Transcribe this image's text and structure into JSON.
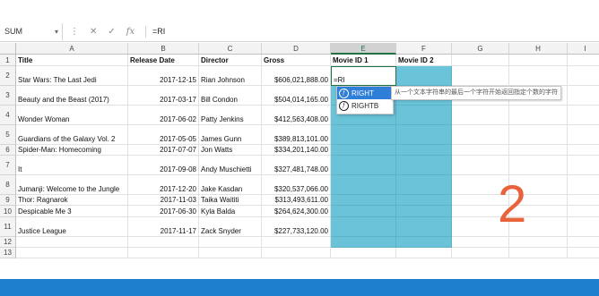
{
  "formula_bar": {
    "name_box": "SUM",
    "cancel_icon": "✕",
    "enter_icon": "✓",
    "fx_label": "fx",
    "formula": "=RI"
  },
  "columns": [
    "A",
    "B",
    "C",
    "D",
    "E",
    "F",
    "G",
    "H",
    "I"
  ],
  "rows": [
    {
      "num": "1",
      "cells": [
        "Title",
        "Release Date",
        "Director",
        "Gross",
        "Movie ID 1",
        "Movie ID 2"
      ]
    },
    {
      "num": "2",
      "cells": [
        "Star Wars: The Last Jedi",
        "2017-12-15",
        "Rian Johnson",
        "$606,021,888.00",
        "=RI",
        ""
      ]
    },
    {
      "num": "3",
      "cells": [
        "Beauty and the Beast (2017)",
        "2017-03-17",
        "Bill Condon",
        "$504,014,165.00",
        "",
        ""
      ]
    },
    {
      "num": "4",
      "cells": [
        "Wonder Woman",
        "2017-06-02",
        "Patty Jenkins",
        "$412,563,408.00",
        "",
        ""
      ]
    },
    {
      "num": "5",
      "cells": [
        "Guardians of the Galaxy Vol. 2",
        "2017-05-05",
        "James Gunn",
        "$389,813,101.00",
        "",
        ""
      ]
    },
    {
      "num": "6",
      "cells": [
        "Spider-Man: Homecoming",
        "2017-07-07",
        "Jon Watts",
        "$334,201,140.00",
        "",
        ""
      ]
    },
    {
      "num": "7",
      "cells": [
        "It",
        "2017-09-08",
        "Andy Muschietti",
        "$327,481,748.00",
        "",
        ""
      ]
    },
    {
      "num": "8",
      "cells": [
        "Jumanji: Welcome to the Jungle",
        "2017-12-20",
        "Jake Kasdan",
        "$320,537,066.00",
        "",
        ""
      ]
    },
    {
      "num": "9",
      "cells": [
        "Thor: Ragnarok",
        "2017-11-03",
        "Taika Waititi",
        "$313,493,611.00",
        "",
        ""
      ]
    },
    {
      "num": "10",
      "cells": [
        "Despicable Me 3",
        "2017-06-30",
        "Kyla Balda",
        "$264,624,300.00",
        "",
        ""
      ]
    },
    {
      "num": "11",
      "cells": [
        "Justice League",
        "2017-11-17",
        "Zack Snyder",
        "$227,733,120.00",
        "",
        ""
      ]
    },
    {
      "num": "12",
      "cells": [
        "",
        "",
        "",
        "",
        "",
        ""
      ]
    },
    {
      "num": "13",
      "cells": [
        "",
        "",
        "",
        "",
        "",
        ""
      ]
    }
  ],
  "autocomplete": {
    "items": [
      {
        "label": "RIGHT",
        "icon": "function-icon"
      },
      {
        "label": "RIGHTB",
        "icon": "function-icon"
      }
    ],
    "tooltip": "从一个文本字符串的最后一个字符开始返回指定个数的字符"
  },
  "overlay_number": "2",
  "colors": {
    "highlight": "#6ac3d9",
    "accent": "#217346",
    "overlay": "#e8633a",
    "banner": "#1f7fcf"
  }
}
